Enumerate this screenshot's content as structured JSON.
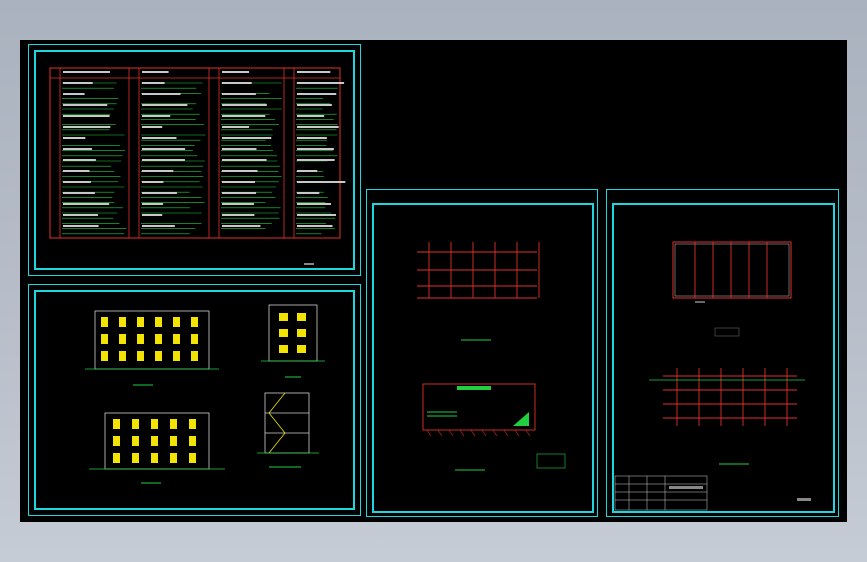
{
  "window": {
    "background_top": "#aab2bf",
    "background_bottom": "#c6ccd5"
  },
  "canvas": {
    "background": "#000000"
  },
  "colors": {
    "frame": "#1fd6e0",
    "grid_red": "#e0302a",
    "table_green": "#20d040",
    "window_yellow": "#f2e400",
    "ground_green": "#20d040",
    "text": "#c8c8c8"
  },
  "sheets": [
    {
      "id": "spec-table",
      "name": "specification-table-sheet"
    },
    {
      "id": "elevations",
      "name": "elevations-sheet"
    },
    {
      "id": "foundation",
      "name": "foundation-plan-sheet"
    },
    {
      "id": "roof",
      "name": "roof-structure-sheet"
    }
  ],
  "title_block": {
    "label": "title-block"
  }
}
